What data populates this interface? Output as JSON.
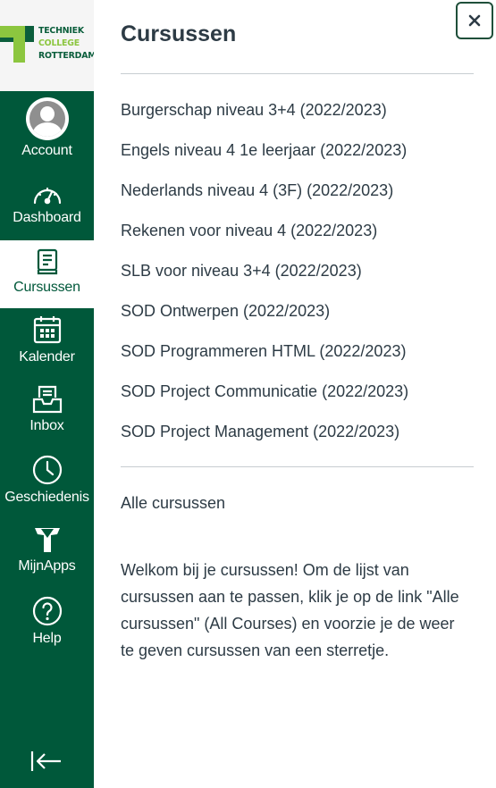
{
  "logo": {
    "line1": "TECHNIEK",
    "line2": "COLLEGE",
    "line3": "ROTTERDAM"
  },
  "nav": {
    "account": "Account",
    "dashboard": "Dashboard",
    "courses": "Cursussen",
    "calendar": "Kalender",
    "inbox": "Inbox",
    "history": "Geschiedenis",
    "apps": "MijnApps",
    "help": "Help"
  },
  "tray": {
    "title": "Cursussen",
    "close_icon": "close-icon",
    "courses": [
      "Burgerschap niveau 3+4 (2022/2023)",
      "Engels niveau 4 1e leerjaar (2022/2023)",
      "Nederlands niveau 4 (3F) (2022/2023)",
      "Rekenen voor niveau 4 (2022/2023)",
      "SLB voor niveau 3+4 (2022/2023)",
      "SOD Ontwerpen (2022/2023)",
      "SOD Programmeren HTML (2022/2023)",
      "SOD Project Communicatie (2022/2023)",
      "SOD Project Management (2022/2023)"
    ],
    "all_courses": "Alle cursussen",
    "welcome": "Welkom bij je cursussen! Om de lijst van cursussen aan te passen, klik je op de link \"Alle cursussen\" (All Courses) en voorzie je de weer te geven cursussen van een sterretje."
  },
  "colors": {
    "sidebar": "#00583a",
    "text": "#2d3b45",
    "accent_green": "#8cc63f"
  }
}
